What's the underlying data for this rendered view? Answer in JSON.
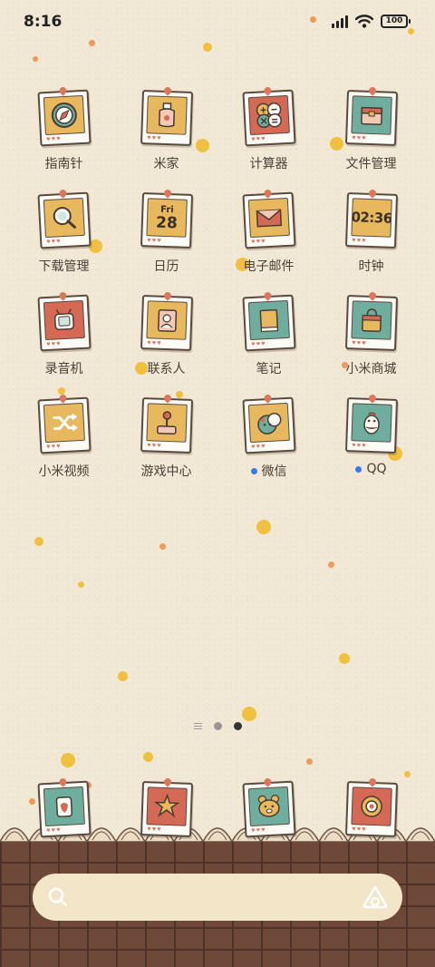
{
  "status_bar": {
    "time": "8:16",
    "battery": "100"
  },
  "apps": [
    {
      "label": "指南针",
      "icon": "compass-icon"
    },
    {
      "label": "米家",
      "icon": "mijia-icon"
    },
    {
      "label": "计算器",
      "icon": "calculator-icon"
    },
    {
      "label": "文件管理",
      "icon": "file-manager-icon"
    },
    {
      "label": "下载管理",
      "icon": "download-manager-icon"
    },
    {
      "label": "日历",
      "icon": "calendar-icon",
      "day": "Fri",
      "date": "28"
    },
    {
      "label": "电子邮件",
      "icon": "mail-icon"
    },
    {
      "label": "时钟",
      "icon": "clock-icon",
      "time": "02:36"
    },
    {
      "label": "录音机",
      "icon": "recorder-icon"
    },
    {
      "label": "联系人",
      "icon": "contacts-icon"
    },
    {
      "label": "笔记",
      "icon": "notes-icon"
    },
    {
      "label": "小米商城",
      "icon": "mi-store-icon"
    },
    {
      "label": "小米视频",
      "icon": "mi-video-icon"
    },
    {
      "label": "游戏中心",
      "icon": "game-center-icon"
    },
    {
      "label": "微信",
      "icon": "wechat-icon",
      "notification_dot": true
    },
    {
      "label": "QQ",
      "icon": "qq-icon",
      "notification_dot": true
    }
  ],
  "dock": [
    {
      "icon": "phone-icon"
    },
    {
      "icon": "messages-icon"
    },
    {
      "icon": "camera-icon"
    },
    {
      "icon": "browser-icon"
    }
  ],
  "page_indicator": {
    "pages": 2,
    "current": 2
  },
  "search": {
    "placeholder": ""
  },
  "colors": {
    "background": "#f2e8d6",
    "brick": "#6e4838",
    "accent_dot": "#3a7ae8",
    "search_bg": "#f3e6c8"
  }
}
